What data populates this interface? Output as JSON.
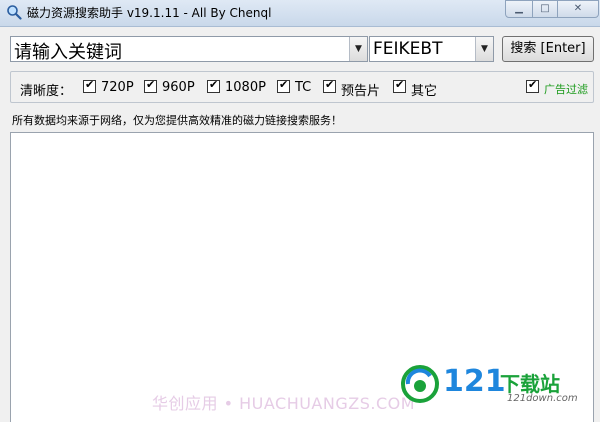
{
  "window": {
    "title": "磁力资源搜索助手 v19.1.11 - All By Chenql"
  },
  "search": {
    "keyword_value": "请输入关键词",
    "engine_value": "FEIKEBT",
    "button_label": "搜索 [Enter]"
  },
  "resolution": {
    "label": "清晰度：",
    "options": [
      {
        "label": "720P",
        "checked": true
      },
      {
        "label": "960P",
        "checked": true
      },
      {
        "label": "1080P",
        "checked": true
      },
      {
        "label": "TC",
        "checked": true
      },
      {
        "label": "预告片",
        "checked": true
      },
      {
        "label": "其它",
        "checked": true
      }
    ],
    "ad_filter": {
      "label": "广告过滤",
      "checked": true
    }
  },
  "notice": "所有数据均来源于网络，仅为您提供高效精准的磁力链接搜索服务！",
  "watermark": {
    "text": "华创应用 • HUACHUANGZS.COM",
    "brand_number": "121",
    "brand_cn": "下载站",
    "brand_url": "121down.com"
  },
  "colors": {
    "ad_filter_label": "#1a9a1a",
    "brand_blue": "#1e86dd",
    "brand_green": "#1aa23a"
  }
}
